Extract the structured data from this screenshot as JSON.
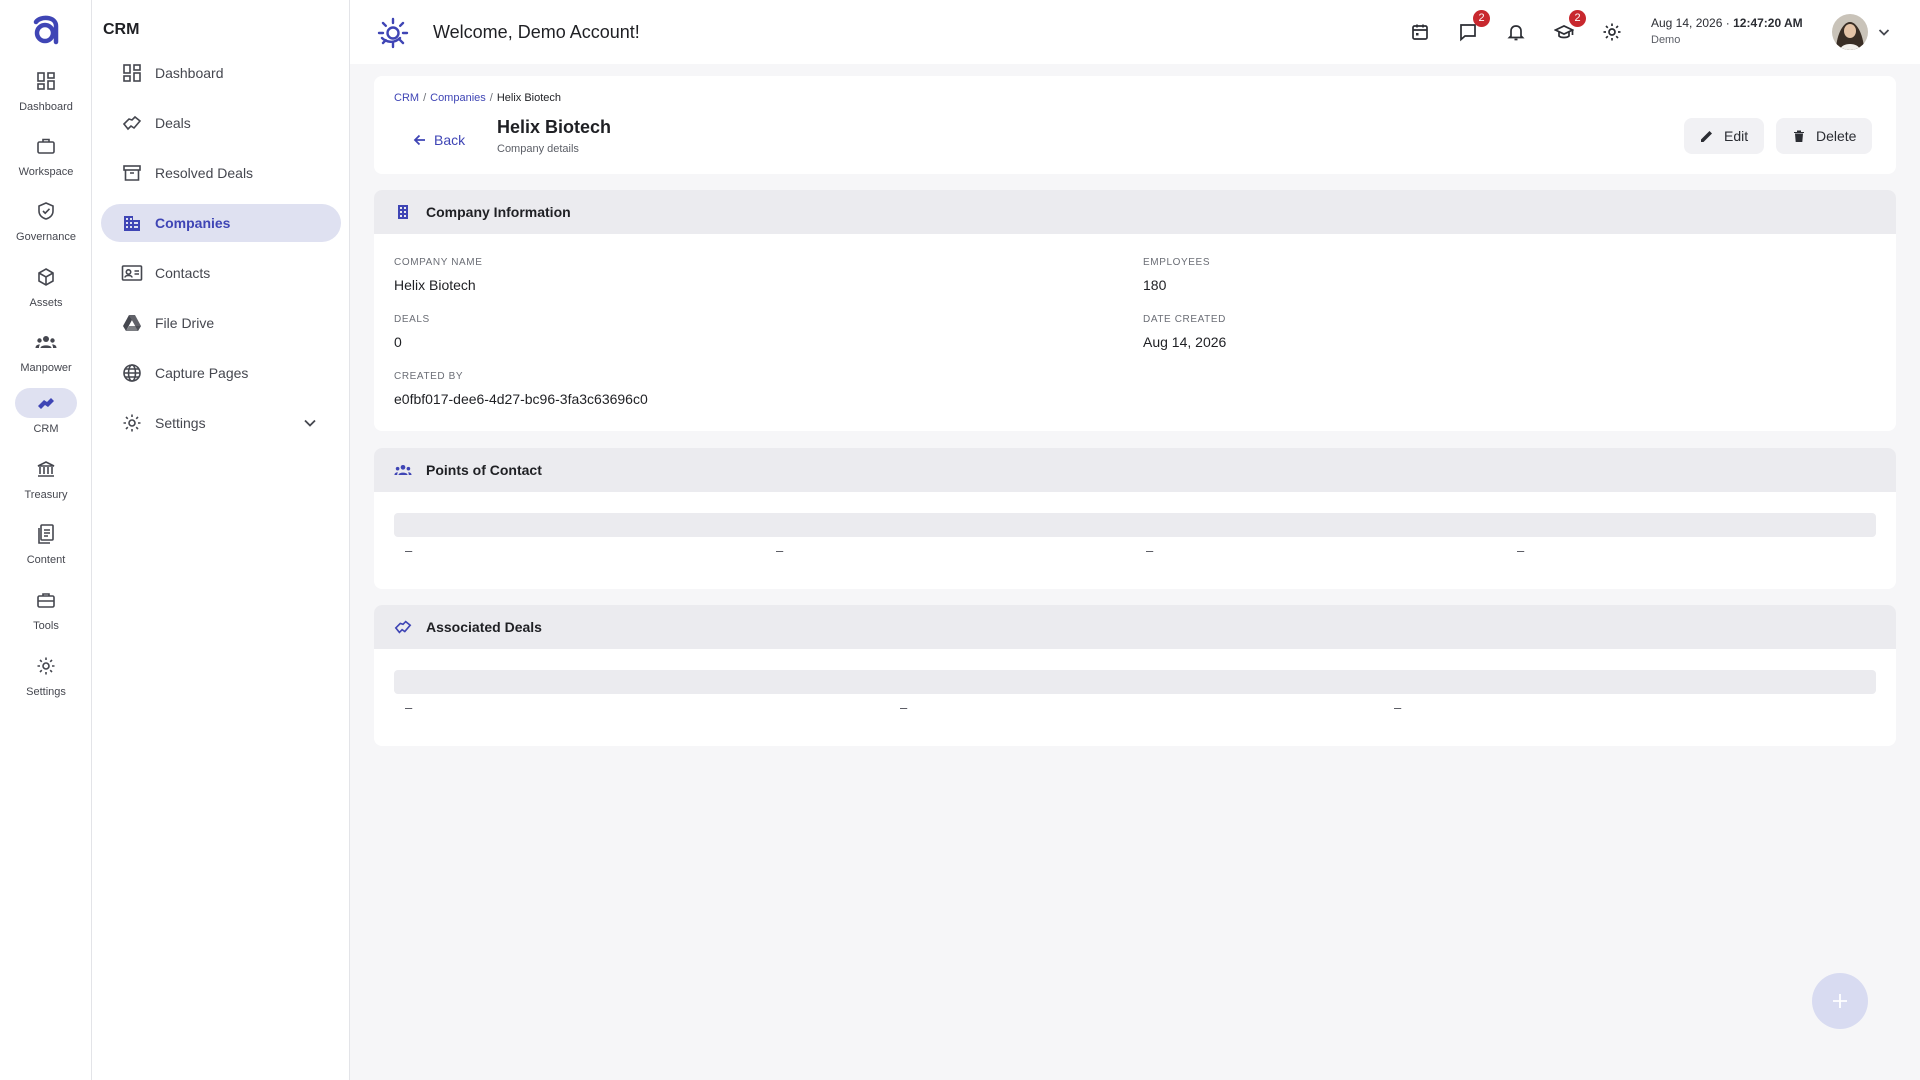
{
  "rail": {
    "items": [
      {
        "label": "Dashboard",
        "icon": "dashboard-icon"
      },
      {
        "label": "Workspace",
        "icon": "briefcase-icon"
      },
      {
        "label": "Governance",
        "icon": "shield-icon"
      },
      {
        "label": "Assets",
        "icon": "cube-icon"
      },
      {
        "label": "Manpower",
        "icon": "people-icon"
      },
      {
        "label": "CRM",
        "icon": "handshake-icon",
        "active": true
      },
      {
        "label": "Treasury",
        "icon": "bank-icon"
      },
      {
        "label": "Content",
        "icon": "document-icon"
      },
      {
        "label": "Tools",
        "icon": "toolbox-icon"
      },
      {
        "label": "Settings",
        "icon": "gear-icon"
      }
    ]
  },
  "sidebar": {
    "title": "CRM",
    "items": [
      {
        "label": "Dashboard",
        "icon": "dashboard-icon"
      },
      {
        "label": "Deals",
        "icon": "handshake-icon"
      },
      {
        "label": "Resolved Deals",
        "icon": "archive-icon"
      },
      {
        "label": "Companies",
        "icon": "building-icon",
        "active": true
      },
      {
        "label": "Contacts",
        "icon": "contact-card-icon"
      },
      {
        "label": "File Drive",
        "icon": "drive-icon"
      },
      {
        "label": "Capture Pages",
        "icon": "globe-icon"
      },
      {
        "label": "Settings",
        "icon": "gear-icon",
        "expandable": true
      }
    ]
  },
  "header": {
    "welcome": "Welcome, Demo Account!",
    "badges": {
      "messages": "2",
      "learning": "2"
    },
    "date": "Aug 14, 2026",
    "separator": "·",
    "time": "12:47:20 AM",
    "user": "Demo"
  },
  "page": {
    "breadcrumb": [
      "CRM",
      "Companies",
      "Helix Biotech"
    ],
    "back_label": "Back",
    "title": "Helix Biotech",
    "subtitle": "Company details",
    "edit_label": "Edit",
    "delete_label": "Delete"
  },
  "company_info": {
    "title": "Company Information",
    "fields": [
      {
        "label": "COMPANY NAME",
        "value": "Helix Biotech"
      },
      {
        "label": "EMPLOYEES",
        "value": "180"
      },
      {
        "label": "DEALS",
        "value": "0"
      },
      {
        "label": "DATE CREATED",
        "value": "Aug 14, 2026"
      },
      {
        "label": "CREATED BY",
        "value": "e0fbf017-dee6-4d27-bc96-3fa3c63696c0"
      }
    ]
  },
  "points_of_contact": {
    "title": "Points of Contact",
    "row": [
      "–",
      "–",
      "–",
      "–"
    ]
  },
  "associated_deals": {
    "title": "Associated Deals",
    "row": [
      "–",
      "–",
      "–"
    ]
  },
  "colors": {
    "accent": "#3f45b5",
    "active_bg": "#dfe1f1",
    "badge": "#c8282e",
    "fab": "#d8dbf1"
  }
}
